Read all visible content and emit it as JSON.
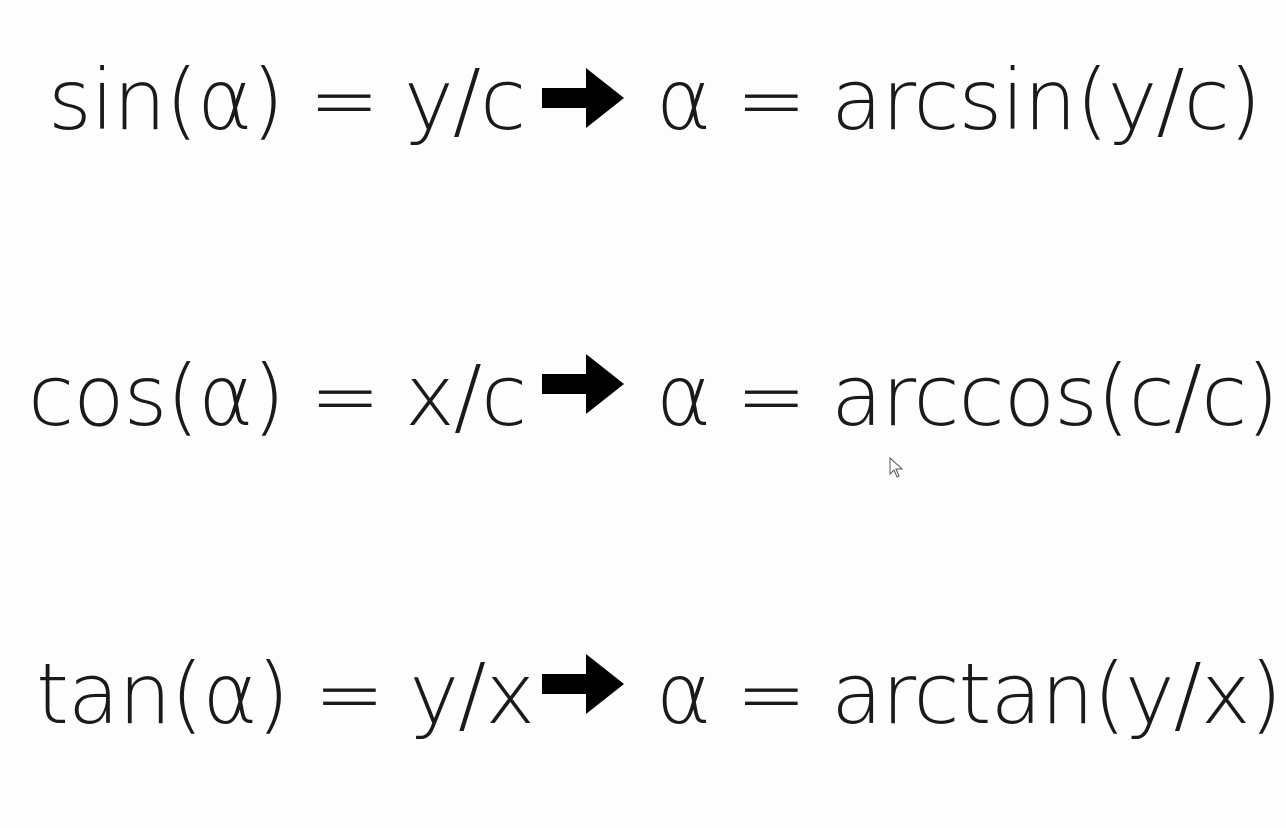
{
  "equations": [
    {
      "lhs": "sin(α) = y/c",
      "arrow_icon": "right-arrow-icon",
      "rhs": "α = arcsin(y/c)"
    },
    {
      "lhs": "cos(α) = x/c",
      "arrow_icon": "right-arrow-icon",
      "rhs": "α = arccos(c/c)"
    },
    {
      "lhs": "tan(α) = y/x",
      "arrow_icon": "right-arrow-icon",
      "rhs": "α = arctan(y/x)"
    }
  ],
  "colors": {
    "background": "#fdfdfd",
    "text": "#1a1a1a",
    "arrow": "#000000"
  },
  "cursor_icon": "mouse-pointer-icon"
}
